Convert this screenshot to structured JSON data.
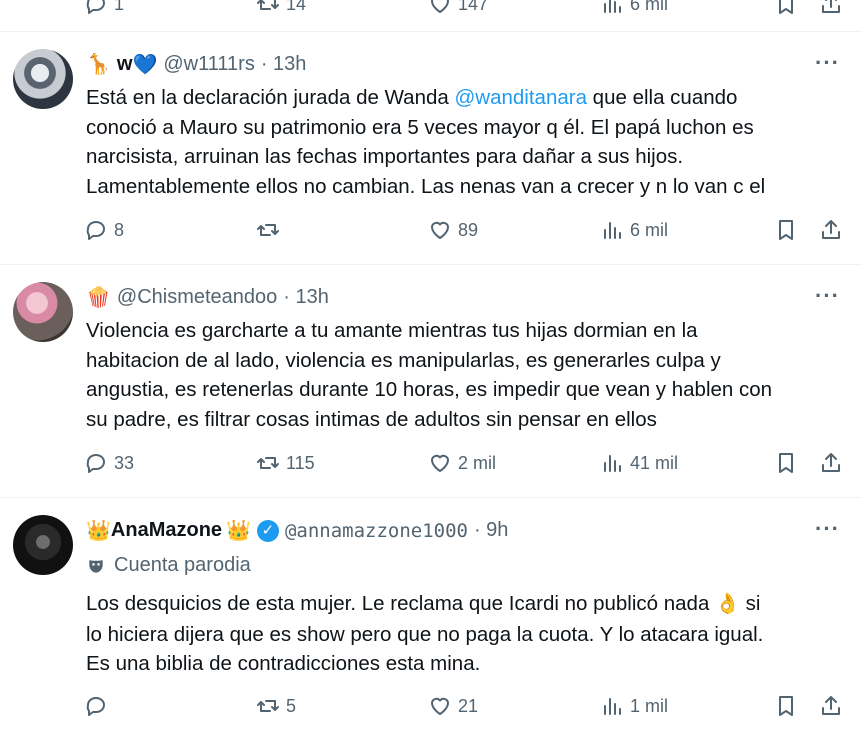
{
  "top_row": {
    "reply": "1",
    "retweet": "14",
    "like": "147",
    "views": "6 mil"
  },
  "tweets": [
    {
      "name_emoji": "🦒",
      "name": "w",
      "name_suffix": "💙",
      "handle": "@w1111rs",
      "time": "· 13h",
      "lines": [
        [
          "Está en la declaración jurada de Wanda ",
          "@wanditanara",
          " que ella cuando"
        ],
        [
          "conoció a Mauro su patrimonio era 5 veces mayor q él. El papá luchon es"
        ],
        [
          "narcisista, arruinan las fechas importantes para dañar a sus hijos."
        ],
        [
          "Lamentablemente ellos no cambian. Las nenas van a crecer y n lo van c el"
        ]
      ],
      "reply": "8",
      "retweet": "",
      "like": "89",
      "views": "6 mil"
    },
    {
      "name_emoji": "🍿",
      "name": "",
      "handle": "@Chismeteandoo",
      "time": "· 13h",
      "lines": [
        [
          "Violencia es garcharte a tu amante mientras tus hijas dormian en la"
        ],
        [
          "habitacion de al lado, violencia es manipularlas, es generarles culpa y"
        ],
        [
          "angustia, es retenerlas durante 10 horas, es impedir que vean y hablen con"
        ],
        [
          "su padre, es filtrar cosas intimas de adultos sin pensar en ellos"
        ]
      ],
      "reply": "33",
      "retweet": "115",
      "like": "2 mil",
      "views": "41 mil"
    },
    {
      "name_emoji": "👑",
      "name": "AnaMazone",
      "name_suffix": "👑",
      "handle": "@annamazzone1000",
      "time": "· 9h",
      "parody": "Cuenta parodia",
      "lines": [
        [
          "Los desquicios de esta mujer. Le reclama que Icardi no publicó nada ",
          "👌",
          " si"
        ],
        [
          "lo hiciera dijera que es show pero que no paga la cuota. Y lo atacara igual."
        ],
        [
          "Es una biblia de contradicciones esta mina."
        ]
      ],
      "reply": "",
      "retweet": "5",
      "like": "21",
      "views": "1 mil"
    }
  ],
  "more_label": "···"
}
